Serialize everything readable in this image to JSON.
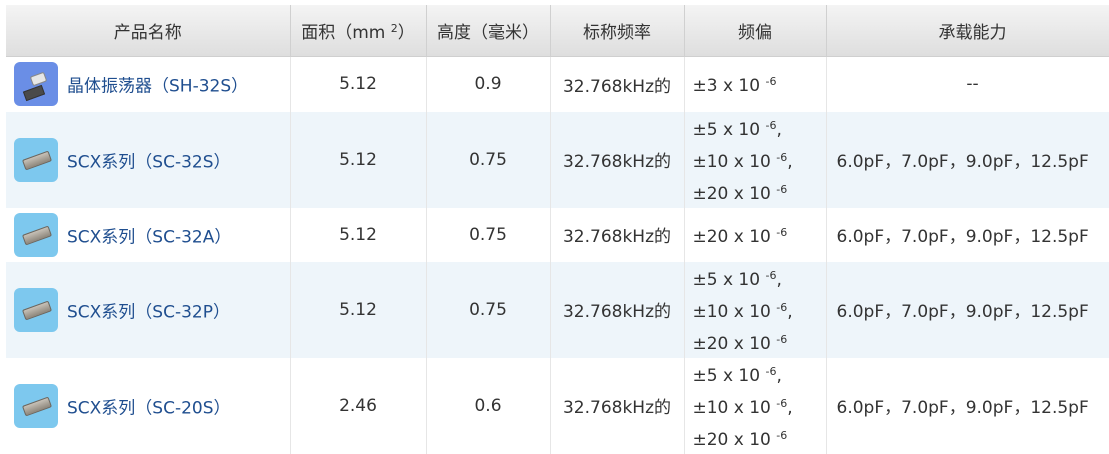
{
  "headers": {
    "product_name": "产品名称",
    "area": "面积（mm",
    "area_sup": "2",
    "area_close": "）",
    "height": "高度（毫米）",
    "nominal_freq": "标称频率",
    "freq_dev": "频偏",
    "load_capacitance": "承载能力"
  },
  "rows": [
    {
      "name": "晶体振荡器（SH-32S）",
      "area": "5.12",
      "height": "0.9",
      "freq": "32.768kHz的",
      "deviation": [
        {
          "base": "±3 x 10",
          "exp": "-6",
          "tail": ""
        }
      ],
      "load": "--"
    },
    {
      "name": "SCX系列（SC-32S）",
      "area": "5.12",
      "height": "0.75",
      "freq": "32.768kHz的",
      "deviation": [
        {
          "base": "±5 x 10",
          "exp": "-6",
          "tail": ","
        },
        {
          "base": "±10 x 10",
          "exp": "-6",
          "tail": ","
        },
        {
          "base": "±20 x 10",
          "exp": "-6",
          "tail": ""
        }
      ],
      "load": "6.0pF，7.0pF，9.0pF，12.5pF"
    },
    {
      "name": "SCX系列（SC-32A）",
      "area": "5.12",
      "height": "0.75",
      "freq": "32.768kHz的",
      "deviation": [
        {
          "base": "±20 x 10",
          "exp": "-6",
          "tail": ""
        }
      ],
      "load": "6.0pF，7.0pF，9.0pF，12.5pF"
    },
    {
      "name": "SCX系列（SC-32P）",
      "area": "5.12",
      "height": "0.75",
      "freq": "32.768kHz的",
      "deviation": [
        {
          "base": "±5 x 10",
          "exp": "-6",
          "tail": ","
        },
        {
          "base": "±10 x 10",
          "exp": "-6",
          "tail": ","
        },
        {
          "base": "±20 x 10",
          "exp": "-6",
          "tail": ""
        }
      ],
      "load": "6.0pF，7.0pF，9.0pF，12.5pF"
    },
    {
      "name": "SCX系列（SC-20S）",
      "area": "2.46",
      "height": "0.6",
      "freq": "32.768kHz的",
      "deviation": [
        {
          "base": "±5 x 10",
          "exp": "-6",
          "tail": ","
        },
        {
          "base": "±10 x 10",
          "exp": "-6",
          "tail": ","
        },
        {
          "base": "±20 x 10",
          "exp": "-6",
          "tail": ""
        }
      ],
      "load": "6.0pF，7.0pF，9.0pF，12.5pF"
    }
  ],
  "colors": {
    "header_bg": "#e4e4e4",
    "row_alt_bg": "#eef5fa",
    "link": "#1f4e8f",
    "oscillator_thumb": "#6a8ee6",
    "crystal_thumb": "#7dc8ee"
  },
  "icons": [
    "oscillator-thumbnail-icon",
    "crystal-thumbnail-icon"
  ]
}
